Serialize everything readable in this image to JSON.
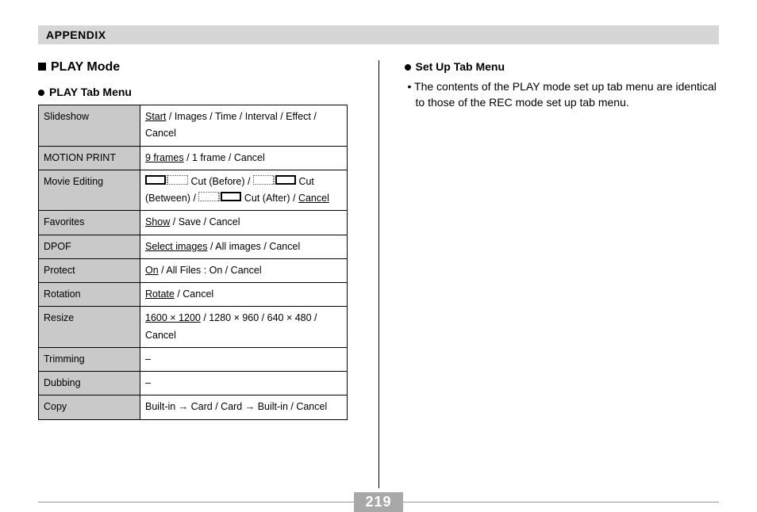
{
  "appendix_label": "APPENDIX",
  "page_number": "219",
  "left": {
    "section_title": "PLAY Mode",
    "tab_title": "PLAY Tab Menu",
    "rows": {
      "slideshow": {
        "label": "Slideshow",
        "start": "Start",
        "rest": " / Images / Time / Interval / Effect / Cancel"
      },
      "motion_print": {
        "label": "MOTION PRINT",
        "nine": "9 frames",
        "rest": " / 1 frame / Cancel"
      },
      "movie_editing": {
        "label": "Movie Editing",
        "cut_before": " Cut (Before) / ",
        "cut_between": " Cut (Between) / ",
        "cut_after": " Cut (After) / ",
        "cancel": "Cancel"
      },
      "favorites": {
        "label": "Favorites",
        "show": "Show",
        "rest": " / Save / Cancel"
      },
      "dpof": {
        "label": "DPOF",
        "select": "Select images",
        "rest": " / All images / Cancel"
      },
      "protect": {
        "label": "Protect",
        "on": "On",
        "rest": " / All Files : On / Cancel"
      },
      "rotation": {
        "label": "Rotation",
        "rotate": "Rotate",
        "rest": " / Cancel"
      },
      "resize": {
        "label": "Resize",
        "first": "1600 × 1200",
        "rest": " / 1280 × 960 / 640 × 480 / Cancel"
      },
      "trimming": {
        "label": "Trimming",
        "val": "–"
      },
      "dubbing": {
        "label": "Dubbing",
        "val": "–"
      },
      "copy": {
        "label": "Copy",
        "val": "Built-in  →  Card / Card  →  Built-in / Cancel"
      }
    }
  },
  "right": {
    "tab_title": "Set Up Tab Menu",
    "note": "The contents of the PLAY mode set up tab menu are identical to those of the REC mode set up tab menu."
  }
}
